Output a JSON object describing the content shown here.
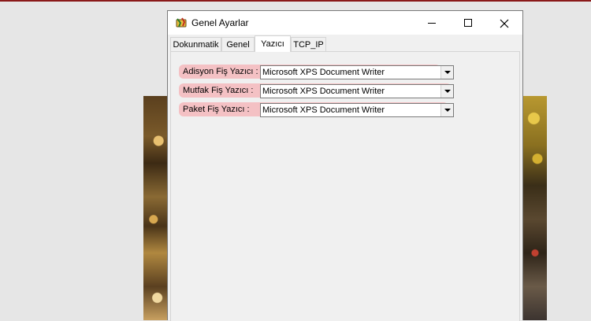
{
  "window": {
    "title": "Genel Ayarlar",
    "controls": {
      "minimize": "minimize",
      "maximize": "maximize",
      "close": "close"
    }
  },
  "tabs": [
    {
      "label": "Dokunmatik"
    },
    {
      "label": "Genel"
    },
    {
      "label": "Yazıcı"
    },
    {
      "label": "TCP_IP"
    }
  ],
  "active_tab": "Yazıcı",
  "printers": [
    {
      "label": "Adisyon Fiş Yazıcı :",
      "value": "Microsoft XPS Document Writer"
    },
    {
      "label": "Mutfak Fiş Yazıcı :",
      "value": "Microsoft XPS Document Writer"
    },
    {
      "label": "Paket Fiş Yazıcı :",
      "value": "Microsoft XPS Document Writer"
    }
  ],
  "colors": {
    "highlight": "#f4b8bc",
    "top_accent": "#8b1a1a",
    "window_bg": "#f0f0f0"
  },
  "icons": [
    "app-icon",
    "minimize-icon",
    "maximize-icon",
    "close-icon",
    "chevron-down-icon"
  ]
}
